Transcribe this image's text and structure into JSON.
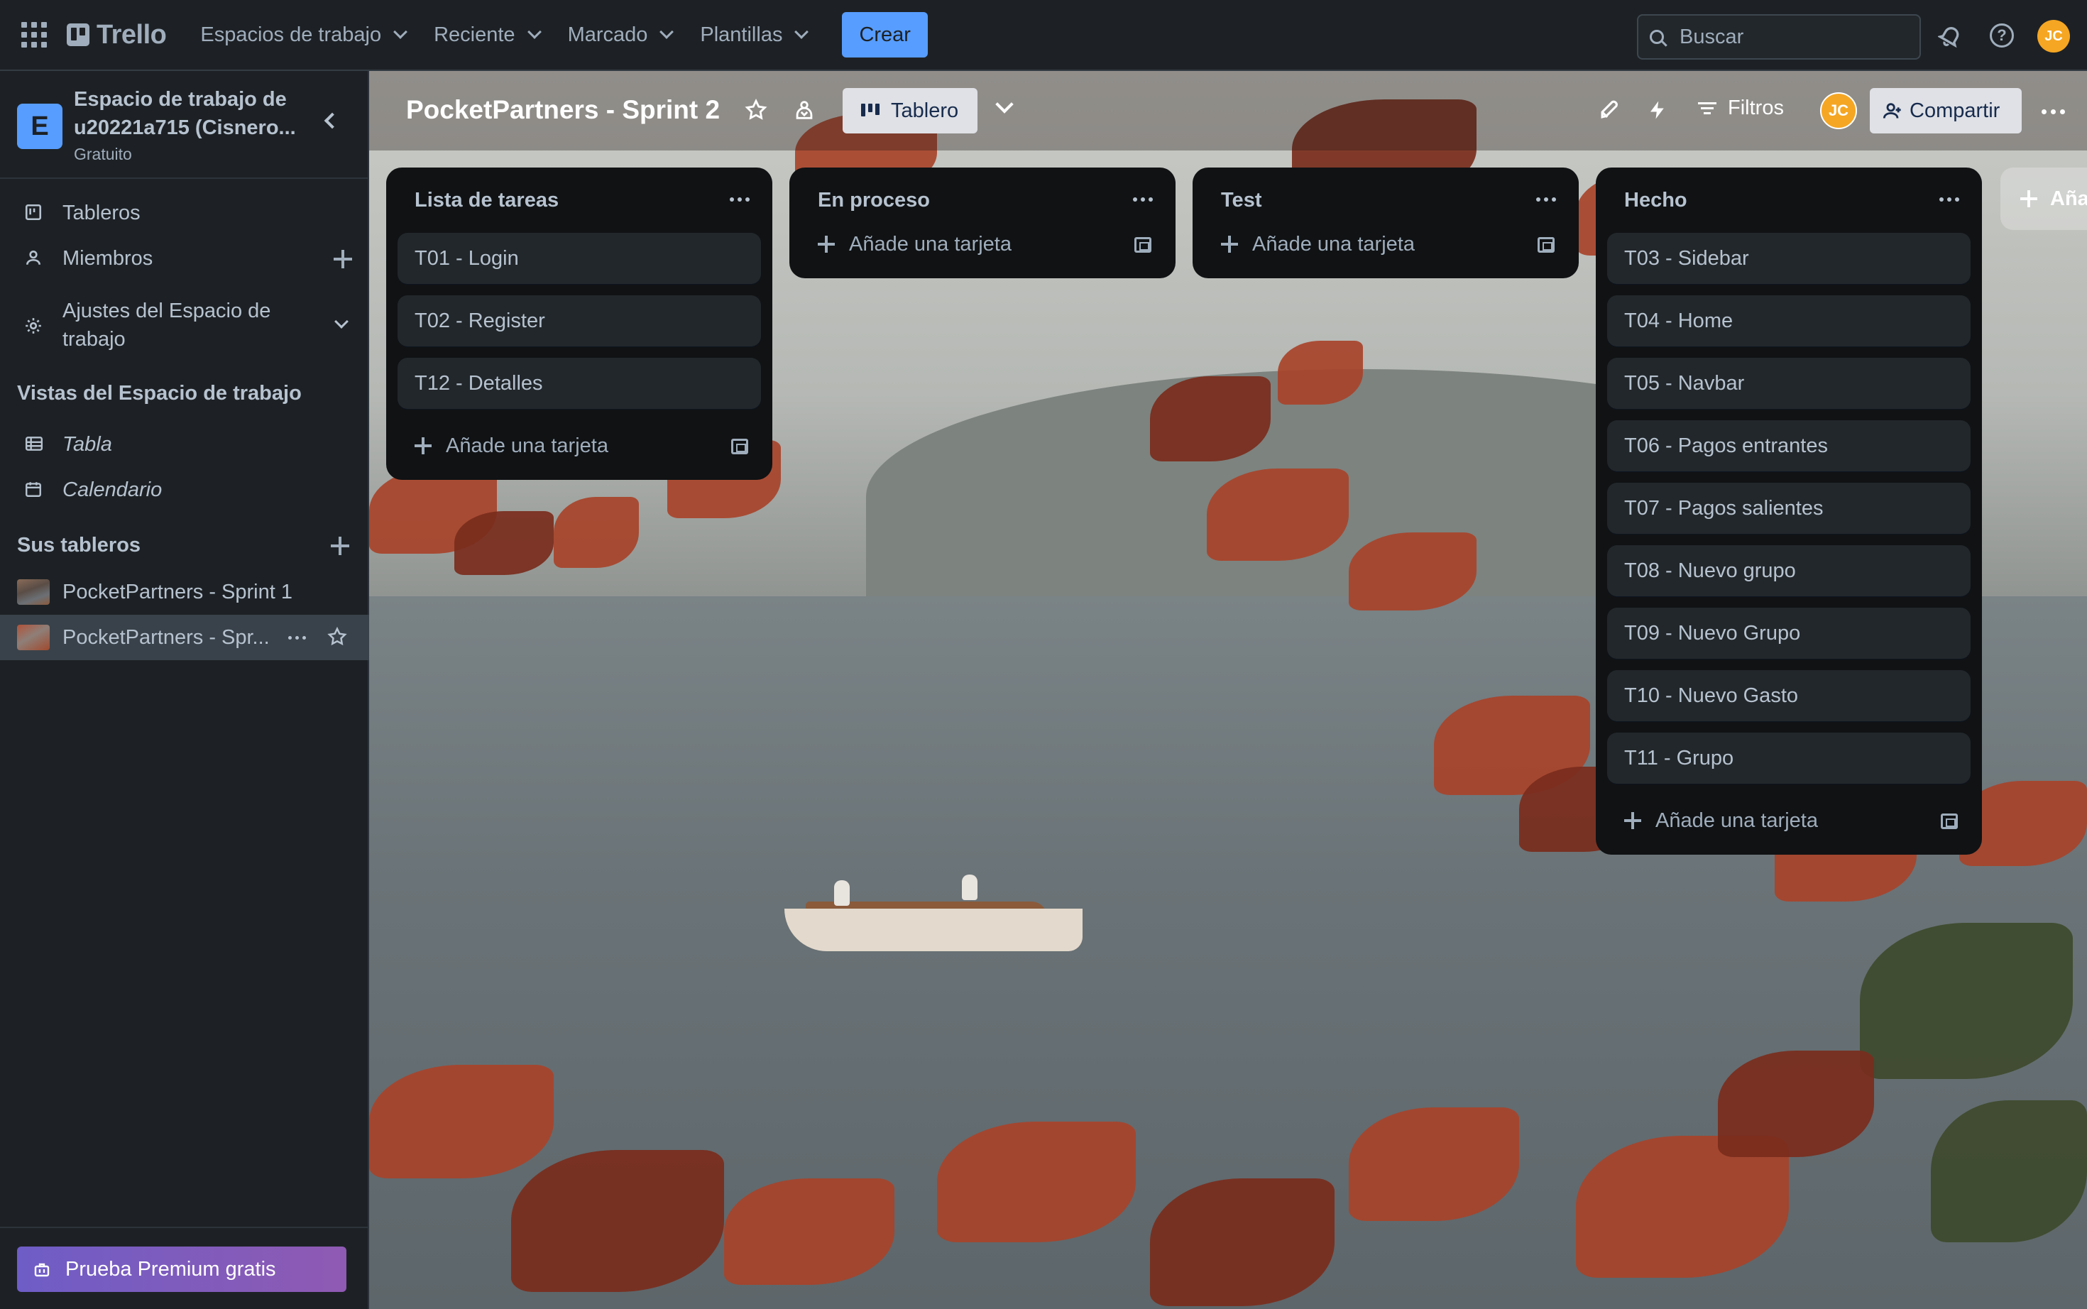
{
  "topbar": {
    "logo": "Trello",
    "nav": [
      {
        "label": "Espacios de trabajo"
      },
      {
        "label": "Reciente"
      },
      {
        "label": "Marcado"
      },
      {
        "label": "Plantillas"
      }
    ],
    "create_label": "Crear",
    "search_placeholder": "Buscar",
    "avatar_initials": "JC"
  },
  "sidebar": {
    "workspace_badge": "E",
    "workspace_name": "Espacio de trabajo de u20221a715 (Cisnero...",
    "workspace_plan": "Gratuito",
    "items": [
      {
        "label": "Tableros"
      },
      {
        "label": "Miembros"
      },
      {
        "label": "Ajustes del Espacio de trabajo"
      }
    ],
    "views_title": "Vistas del Espacio de trabajo",
    "views": [
      {
        "label": "Tabla"
      },
      {
        "label": "Calendario"
      }
    ],
    "boards_title": "Sus tableros",
    "boards": [
      {
        "label": "PocketPartners - Sprint 1"
      },
      {
        "label": "PocketPartners - Spr..."
      }
    ],
    "premium_label": "Prueba Premium gratis"
  },
  "board": {
    "title": "PocketPartners - Sprint 2",
    "view_label": "Tablero",
    "filters_label": "Filtros",
    "share_label": "Compartir",
    "member_initials": "JC",
    "add_list_label": "Aña",
    "lists": [
      {
        "title": "Lista de tareas",
        "cards": [
          "T01 - Login",
          "T02 - Register",
          "T12 - Detalles"
        ],
        "add_label": "Añade una tarjeta"
      },
      {
        "title": "En proceso",
        "cards": [],
        "add_label": "Añade una tarjeta"
      },
      {
        "title": "Test",
        "cards": [],
        "add_label": "Añade una tarjeta"
      },
      {
        "title": "Hecho",
        "cards": [
          "T03 - Sidebar",
          "T04 - Home",
          "T05 - Navbar",
          "T06 - Pagos entrantes",
          "T07 - Pagos salientes",
          "T08 - Nuevo grupo",
          "T09 - Nuevo Grupo",
          "T10 - Nuevo Gasto",
          "T11 - Grupo"
        ],
        "add_label": "Añade una tarjeta"
      }
    ]
  },
  "colors": {
    "accent": "#579dff",
    "avatar": "#f5a623",
    "premium_start": "#6e5dc6",
    "premium_end": "#8f5ab3"
  }
}
